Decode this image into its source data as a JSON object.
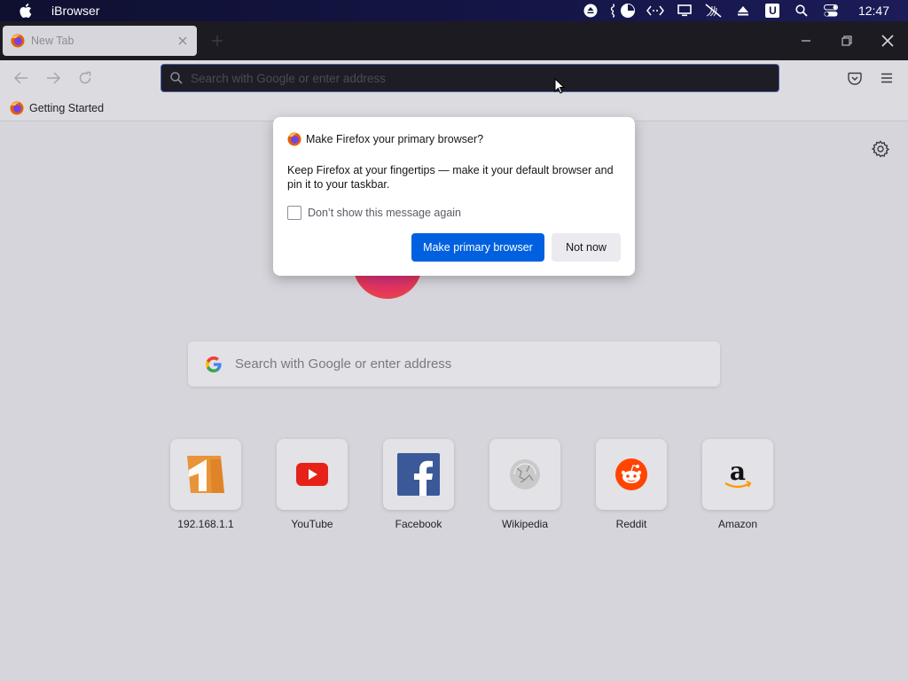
{
  "menubar": {
    "app_name": "iBrowser",
    "clock": "12:47",
    "tray_icons": [
      "eject-icon",
      "pie-chart-icon",
      "code-arrows-icon",
      "display-icon",
      "mute-icon",
      "upload-icon",
      "u-badge-icon",
      "search-icon",
      "control-center-icon"
    ],
    "badge_letter": "U"
  },
  "tabs": [
    {
      "title": "New Tab",
      "active": true
    }
  ],
  "urlbar": {
    "placeholder": "Search with Google or enter address"
  },
  "bookmarks": [
    {
      "label": "Getting Started"
    }
  ],
  "content": {
    "search_placeholder": "Search with Google or enter address",
    "top_sites": [
      {
        "label": "192.168.1.1",
        "icon": "router-icon"
      },
      {
        "label": "YouTube",
        "icon": "youtube-icon"
      },
      {
        "label": "Facebook",
        "icon": "facebook-icon"
      },
      {
        "label": "Wikipedia",
        "icon": "wikipedia-icon"
      },
      {
        "label": "Reddit",
        "icon": "reddit-icon"
      },
      {
        "label": "Amazon",
        "icon": "amazon-icon"
      }
    ]
  },
  "dialog": {
    "title": "Make Firefox your primary browser?",
    "body": "Keep Firefox at your fingertips — make it your default browser and pin it to your taskbar.",
    "checkbox_label": "Don’t show this message again",
    "checkbox_checked": false,
    "primary_button": "Make primary browser",
    "secondary_button": "Not now"
  },
  "colors": {
    "accent": "#0061e0",
    "tabstrip_bg": "#1c1b22",
    "content_bg": "#d6d5db",
    "urlbar_bg": "#1e1d26"
  }
}
